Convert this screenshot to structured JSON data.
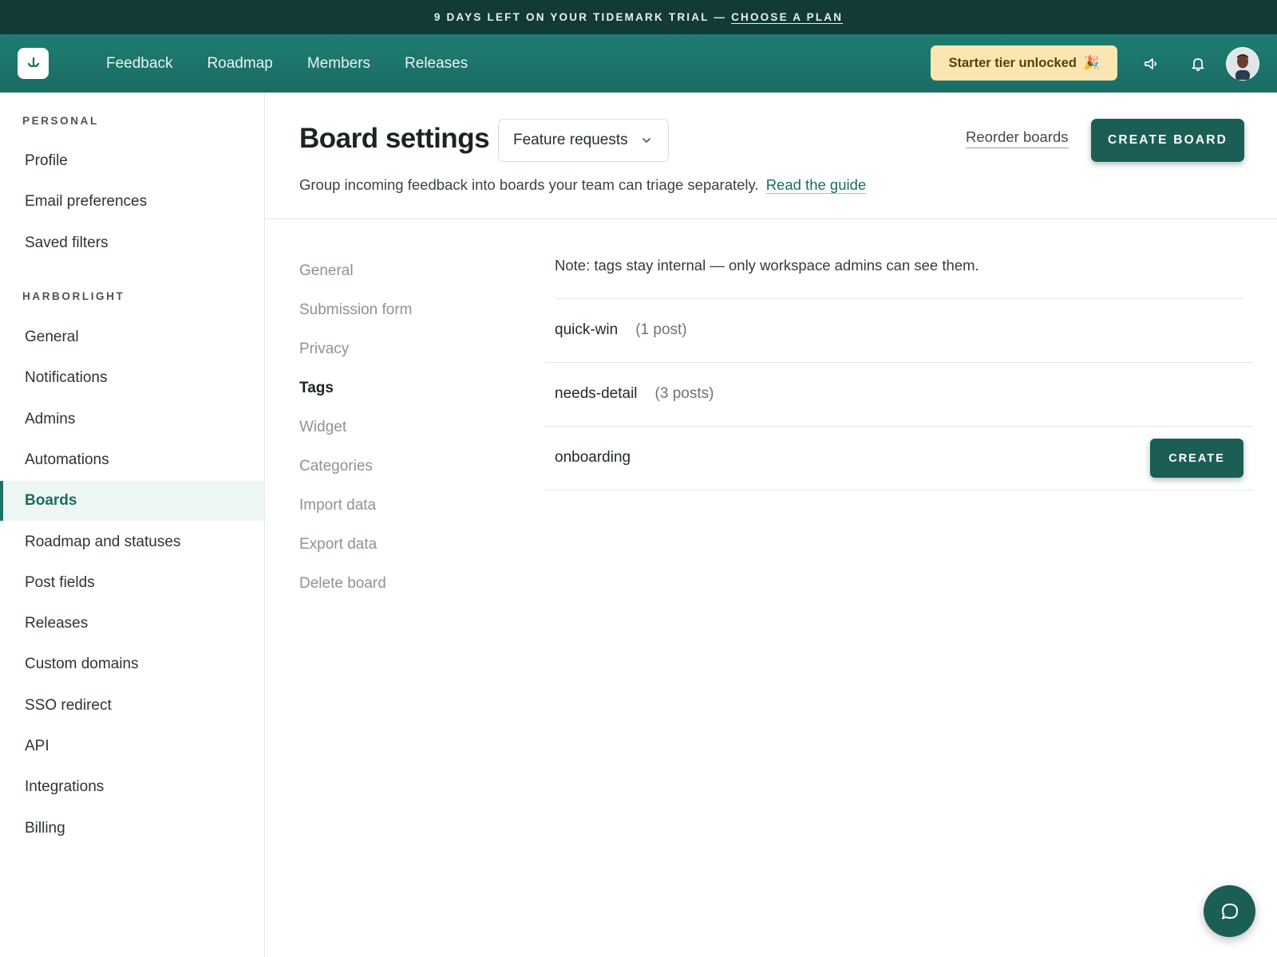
{
  "banner": {
    "text": "9 DAYS LEFT ON YOUR TIDEMARK TRIAL —",
    "link": "CHOOSE A PLAN"
  },
  "topnav": {
    "links": [
      "Feedback",
      "Roadmap",
      "Members",
      "Releases"
    ],
    "tier_badge": "Starter tier unlocked",
    "tier_emoji": "🎉"
  },
  "sidebar": {
    "personal_heading": "PERSONAL",
    "personal_items": [
      "Profile",
      "Email preferences",
      "Saved filters"
    ],
    "workspace_heading": "HARBORLIGHT",
    "workspace_items": [
      "General",
      "Notifications",
      "Admins",
      "Automations",
      "Boards",
      "Roadmap and statuses",
      "Post fields",
      "Releases",
      "Custom domains",
      "SSO redirect",
      "API",
      "Integrations",
      "Billing"
    ],
    "active_item": "Boards"
  },
  "header": {
    "title": "Board settings",
    "board_select": "Feature requests",
    "reorder_label": "Reorder boards",
    "create_board_label": "CREATE BOARD",
    "subtitle": "Group incoming feedback into boards your team can triage separately.",
    "guide_link": "Read the guide"
  },
  "subnav": {
    "items": [
      "General",
      "Submission form",
      "Privacy",
      "Tags",
      "Widget",
      "Categories",
      "Import data",
      "Export data",
      "Delete board"
    ],
    "active_item": "Tags"
  },
  "tags": {
    "note": "Note: tags stay internal — only workspace admins can see them.",
    "rows": [
      {
        "name": "quick-win",
        "count": "(1 post)"
      },
      {
        "name": "needs-detail",
        "count": "(3 posts)"
      }
    ],
    "new_tag_value": "onboarding",
    "create_label": "CREATE"
  },
  "colors": {
    "banner_bg": "#123a37",
    "nav_bg": "#1f7c71",
    "primary": "#1b5e56",
    "badge_bg": "#fbe6b3",
    "active_bg": "#eef6f3"
  },
  "icons": {
    "logo": "tidemark-logo-icon",
    "announcements": "megaphone-icon",
    "notifications": "bell-icon",
    "chat": "chat-bubble-icon"
  }
}
